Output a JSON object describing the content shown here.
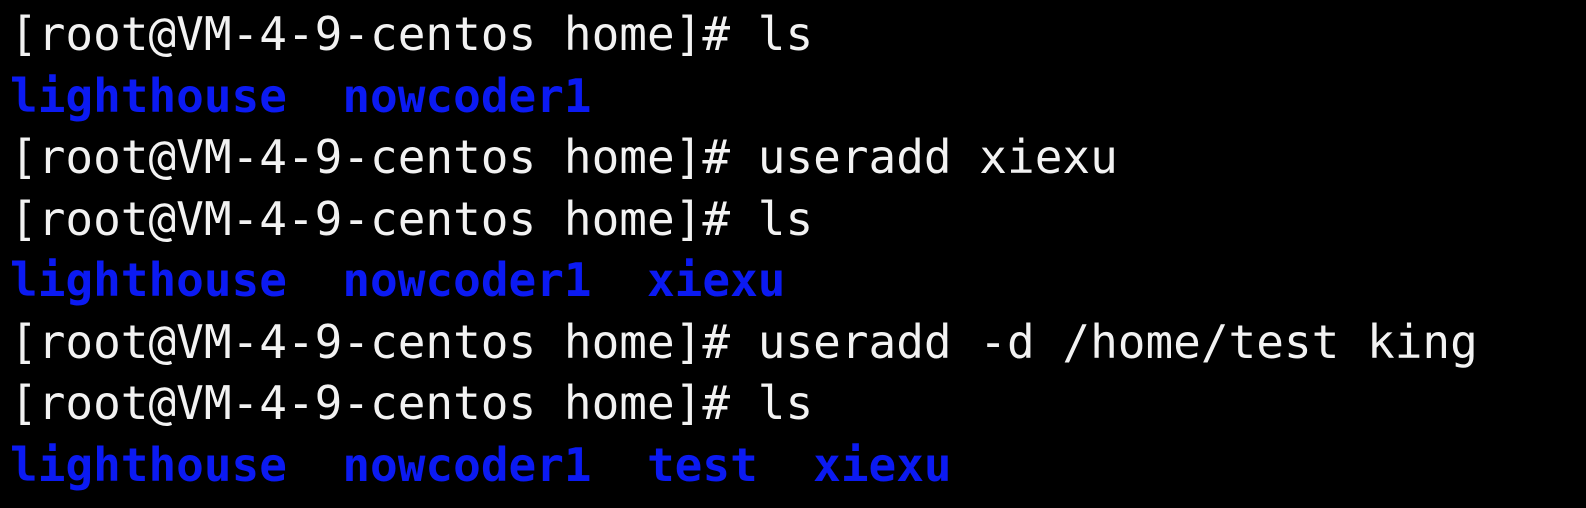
{
  "colors": {
    "background": "#000000",
    "text": "#f2f2f2",
    "directory": "#0b1af2"
  },
  "lines": [
    {
      "type": "prompt",
      "prompt": "[root@VM-4-9-centos home]# ",
      "command": "ls"
    },
    {
      "type": "output",
      "items": [
        "lighthouse",
        "nowcoder1"
      ]
    },
    {
      "type": "prompt",
      "prompt": "[root@VM-4-9-centos home]# ",
      "command": "useradd xiexu"
    },
    {
      "type": "prompt",
      "prompt": "[root@VM-4-9-centos home]# ",
      "command": "ls"
    },
    {
      "type": "output",
      "items": [
        "lighthouse",
        "nowcoder1",
        "xiexu"
      ]
    },
    {
      "type": "prompt",
      "prompt": "[root@VM-4-9-centos home]# ",
      "command": "useradd -d /home/test king"
    },
    {
      "type": "prompt",
      "prompt": "[root@VM-4-9-centos home]# ",
      "command": "ls"
    },
    {
      "type": "output",
      "items": [
        "lighthouse",
        "nowcoder1",
        "test",
        "xiexu"
      ]
    }
  ]
}
